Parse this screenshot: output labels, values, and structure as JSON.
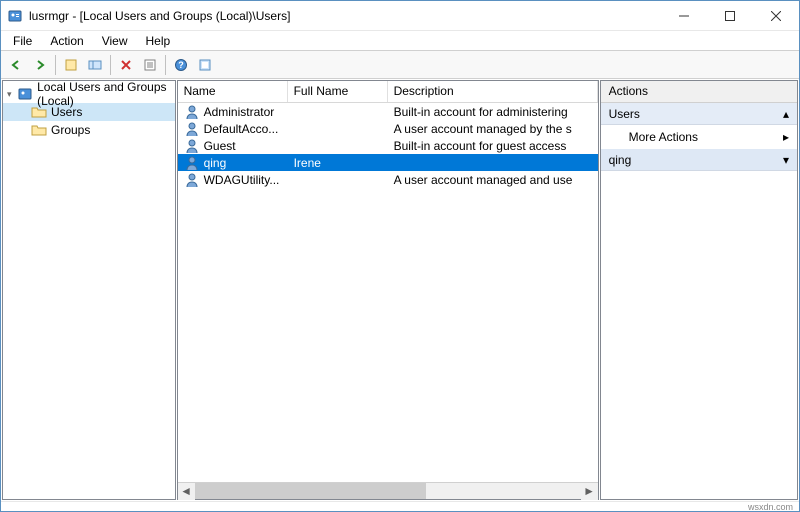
{
  "window": {
    "title": "lusrmgr - [Local Users and Groups (Local)\\Users]"
  },
  "menu": {
    "file": "File",
    "action": "Action",
    "view": "View",
    "help": "Help"
  },
  "tree": {
    "root": "Local Users and Groups (Local)",
    "users": "Users",
    "groups": "Groups"
  },
  "columns": {
    "name": "Name",
    "fullname": "Full Name",
    "desc": "Description"
  },
  "rows": [
    {
      "name": "Administrator",
      "full": "",
      "desc": "Built-in account for administering"
    },
    {
      "name": "DefaultAcco...",
      "full": "",
      "desc": "A user account managed by the s"
    },
    {
      "name": "Guest",
      "full": "",
      "desc": "Built-in account for guest access"
    },
    {
      "name": "qing",
      "full": "Irene",
      "desc": ""
    },
    {
      "name": "WDAGUtility...",
      "full": "",
      "desc": "A user account managed and use"
    }
  ],
  "selected_row": 3,
  "actions": {
    "header": "Actions",
    "section1": "Users",
    "more": "More Actions",
    "section2": "qing"
  },
  "watermark": "wsxdn.com",
  "colwidths": {
    "name": 110,
    "full": 100,
    "desc": 210
  }
}
